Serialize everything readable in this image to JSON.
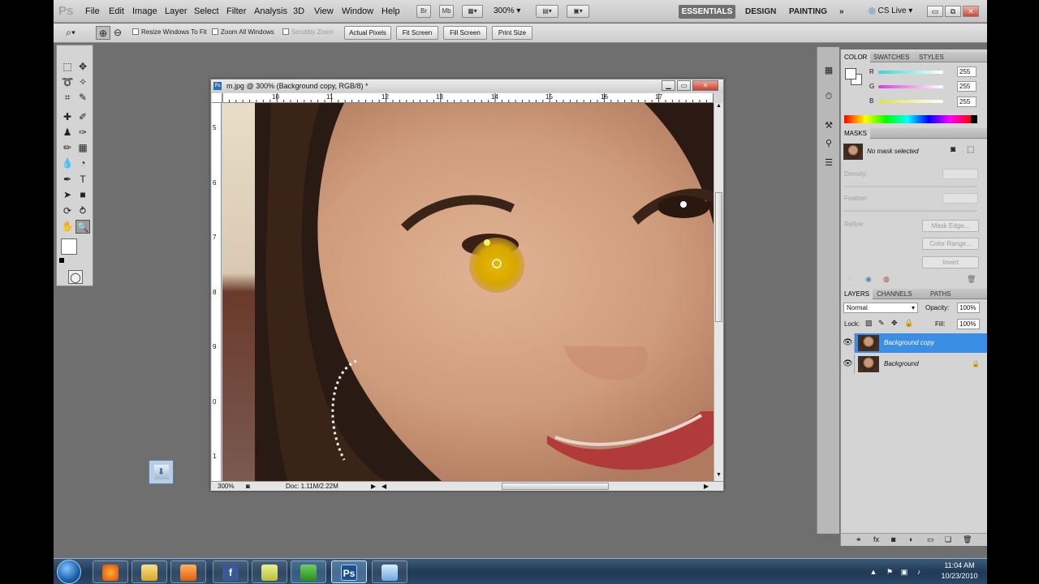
{
  "app": {
    "logo": "Ps",
    "menu": [
      "File",
      "Edit",
      "Image",
      "Layer",
      "Select",
      "Filter",
      "Analysis",
      "3D",
      "View",
      "Window",
      "Help"
    ],
    "bar_buttons": [
      "Br",
      "Mb"
    ],
    "zoom_level": "300%",
    "workspaces": [
      "ESSENTIALS",
      "DESIGN",
      "PAINTING"
    ],
    "more_workspaces": "»",
    "cs_live": "CS Live",
    "window_buttons": [
      "▭",
      "⧉",
      "✕"
    ]
  },
  "options_bar": {
    "resize_windows_label": "Resize Windows To Fit",
    "zoom_all_label": "Zoom All Windows",
    "scrubby_zoom_label": "Scrubby Zoom",
    "actual_pixels": "Actual Pixels",
    "fit_screen": "Fit Screen",
    "fill_screen": "Fill Screen",
    "print_size": "Print Size"
  },
  "document": {
    "title": "m.jpg @ 300% (Background copy, RGB/8) *",
    "ps_badge": "Ps",
    "ruler_top": [
      "10",
      "11",
      "12",
      "13",
      "14",
      "15",
      "16",
      "17"
    ],
    "ruler_left": [
      "5",
      "6",
      "7",
      "8",
      "9",
      "0",
      "1"
    ],
    "zoom": "300%",
    "doc_size": "Doc: 1.11M/2.22M"
  },
  "color_panel": {
    "tabs": [
      "COLOR",
      "SWATCHES",
      "STYLES"
    ],
    "channels": [
      {
        "label": "R",
        "value": "255",
        "color": "#37d6d6"
      },
      {
        "label": "G",
        "value": "255",
        "color": "#d640d6"
      },
      {
        "label": "B",
        "value": "255",
        "color": "#e0e040"
      }
    ]
  },
  "masks_panel": {
    "tab": "MASKS",
    "status": "No mask selected",
    "density_label": "Density:",
    "feather_label": "Feather:",
    "refine_label": "Refine:",
    "mask_edge": "Mask Edge...",
    "color_range": "Color Range...",
    "invert": "Invert"
  },
  "layers_panel": {
    "tabs": [
      "LAYERS",
      "CHANNELS",
      "PATHS"
    ],
    "blend_mode": "Normal",
    "opacity_label": "Opacity:",
    "opacity_value": "100%",
    "lock_label": "Lock:",
    "fill_label": "Fill:",
    "fill_value": "100%",
    "layers": [
      {
        "name": "Background copy",
        "selected": true
      },
      {
        "name": "Background",
        "selected": false
      }
    ]
  },
  "taskbar": {
    "time": "11:04 AM",
    "date": "10/23/2010",
    "ps_label": "Ps",
    "fb_label": "f"
  },
  "colors": {
    "accent_selected_layer": "#3a8ee6",
    "eye_highlight": "#d8b000"
  }
}
